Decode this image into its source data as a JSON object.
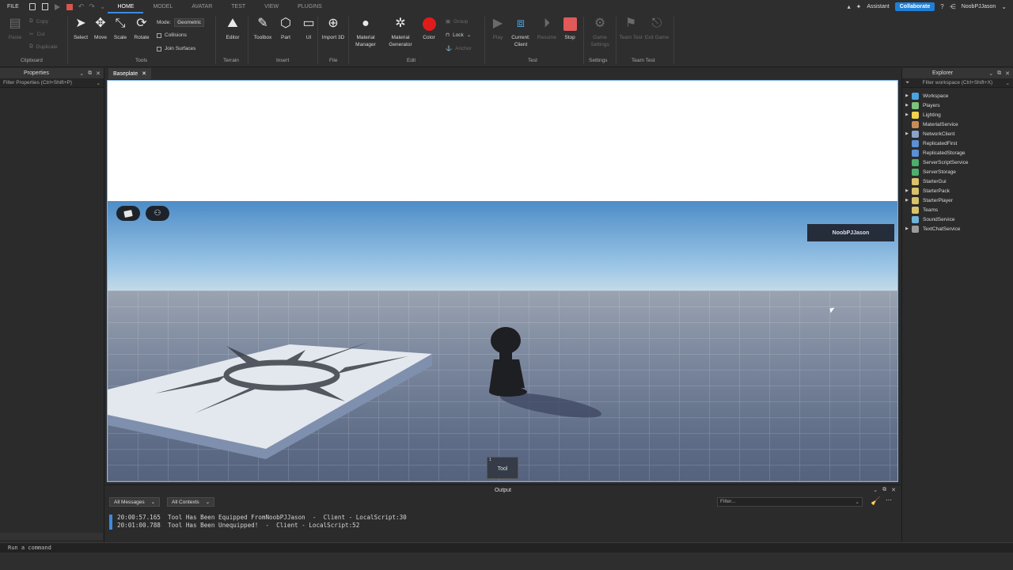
{
  "menubar": {
    "file": "FILE",
    "tabs": [
      "HOME",
      "MODEL",
      "AVATAR",
      "TEST",
      "VIEW",
      "PLUGINS"
    ],
    "active_tab": "HOME",
    "assistant": "Assistant",
    "collaborate": "Collaborate",
    "username": "NoobPJJason"
  },
  "ribbon": {
    "clipboard": {
      "paste": "Paste",
      "copy": "Copy",
      "cut": "Cut",
      "duplicate": "Duplicate",
      "group": "Clipboard"
    },
    "tools": {
      "select": "Select",
      "move": "Move",
      "scale": "Scale",
      "rotate": "Rotate",
      "group": "Tools",
      "mode_label": "Mode:",
      "mode_value": "Geometric",
      "collisions": "Collisions",
      "join_surfaces": "Join Surfaces"
    },
    "terrain": {
      "editor": "Editor",
      "group": "Terrain"
    },
    "insert": {
      "toolbox": "Toolbox",
      "part": "Part",
      "ui": "UI",
      "group": "Insert"
    },
    "file": {
      "import3d": "Import 3D",
      "group": "File"
    },
    "edit": {
      "material_manager": "Material Manager",
      "material_generator": "Material Generator",
      "color": "Color",
      "group_btn": "Group",
      "lock": "Lock",
      "anchor": "Anchor",
      "group": "Edit"
    },
    "test": {
      "play": "Play",
      "current_client": "Current: Client",
      "resume": "Resume",
      "stop": "Stop",
      "group": "Test"
    },
    "settings": {
      "game_settings": "Game Settings",
      "group": "Settings"
    },
    "team_test": {
      "team_test": "Team Test",
      "exit_game": "Exit Game",
      "group": "Team Test"
    }
  },
  "properties": {
    "title": "Properties",
    "filter_placeholder": "Filter Properties (Ctrl+Shift+P)"
  },
  "document": {
    "tab": "Baseplate"
  },
  "viewport": {
    "player_name": "NoobPJJason",
    "tool_slot_number": "1",
    "tool_name": "Tool"
  },
  "output": {
    "title": "Output",
    "messages_filter": "All Messages",
    "contexts_filter": "All Contexts",
    "filter_placeholder": "Filter...",
    "lines": [
      "20:00:57.165  Tool Has Been Equipped FromNoobPJJason  -  Client - LocalScript:30",
      "20:01:00.788  Tool Has Been Unequipped!  -  Client - LocalScript:52"
    ]
  },
  "explorer": {
    "title": "Explorer",
    "filter_placeholder": "Filter workspace (Ctrl+Shift+X)",
    "items": [
      {
        "name": "Workspace",
        "expandable": true,
        "color": "#4aa3df"
      },
      {
        "name": "Players",
        "expandable": true,
        "color": "#7cc47a"
      },
      {
        "name": "Lighting",
        "expandable": true,
        "color": "#f2d24b"
      },
      {
        "name": "MaterialService",
        "expandable": false,
        "color": "#c98b5a"
      },
      {
        "name": "NetworkClient",
        "expandable": true,
        "color": "#8aa4c8"
      },
      {
        "name": "ReplicatedFirst",
        "expandable": false,
        "color": "#5b8fd6"
      },
      {
        "name": "ReplicatedStorage",
        "expandable": false,
        "color": "#5b8fd6"
      },
      {
        "name": "ServerScriptService",
        "expandable": false,
        "color": "#4caf6b"
      },
      {
        "name": "ServerStorage",
        "expandable": false,
        "color": "#4caf6b"
      },
      {
        "name": "StarterGui",
        "expandable": false,
        "color": "#d9c26a"
      },
      {
        "name": "StarterPack",
        "expandable": true,
        "color": "#d9c26a"
      },
      {
        "name": "StarterPlayer",
        "expandable": true,
        "color": "#d9c26a"
      },
      {
        "name": "Teams",
        "expandable": false,
        "color": "#d9c26a"
      },
      {
        "name": "SoundService",
        "expandable": false,
        "color": "#6fb3d8"
      },
      {
        "name": "TextChatService",
        "expandable": true,
        "color": "#9b9b9b"
      }
    ]
  },
  "command_bar": {
    "placeholder": "Run a command"
  },
  "colors": {
    "accent": "#3b8be0",
    "collaborate": "#1f7fd6",
    "stop": "#e05a5a",
    "record": "#e01b1b"
  }
}
